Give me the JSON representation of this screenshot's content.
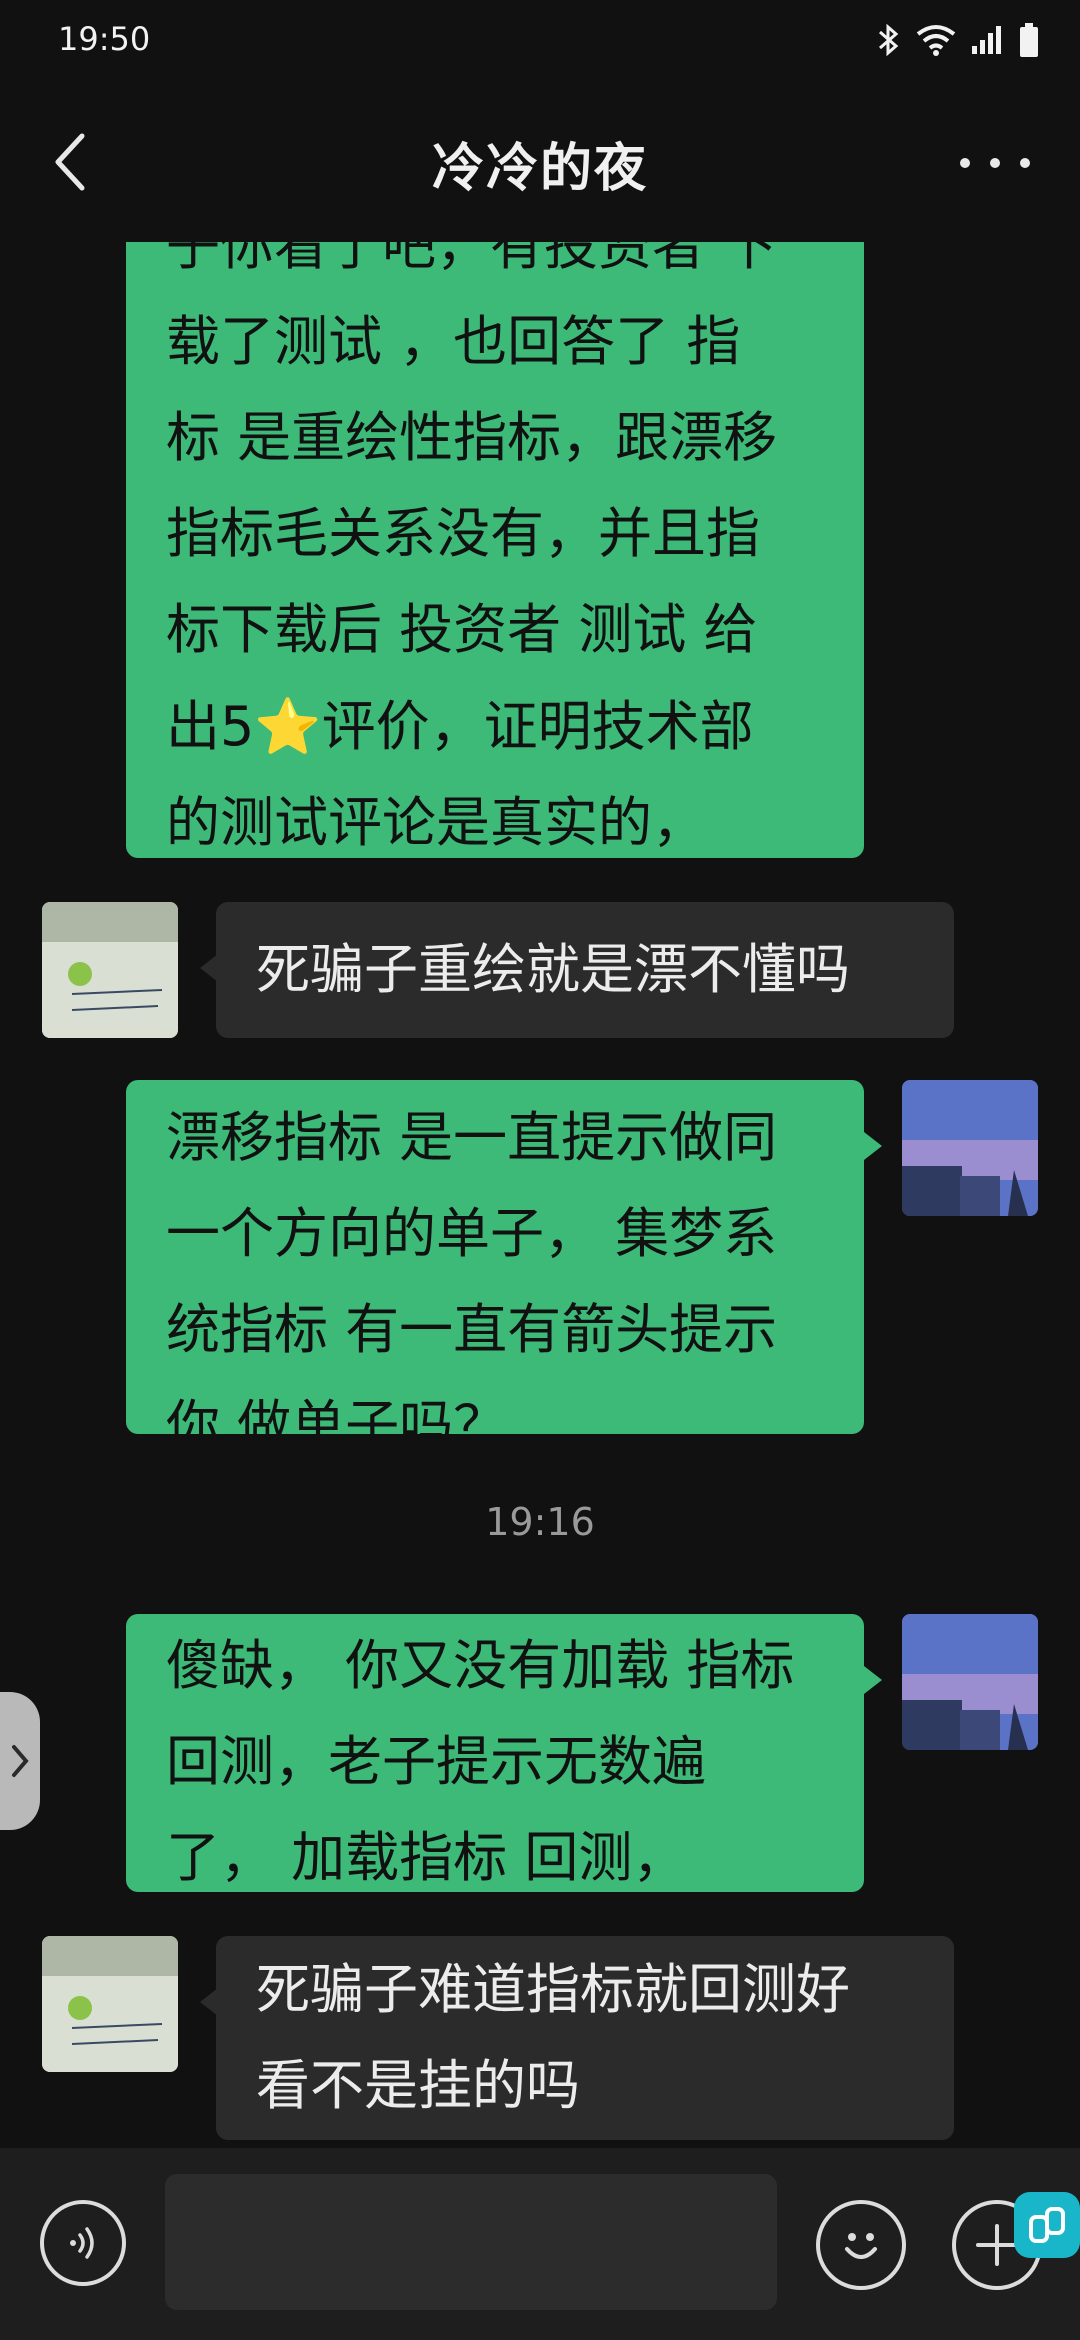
{
  "status_bar": {
    "time": "19:50"
  },
  "header": {
    "title": "冷冷的夜"
  },
  "messages": [
    {
      "side": "out",
      "lines": [
        "子你看了吧，有投资者 下",
        "载了测试 ，也回答了 指",
        "标 是重绘性指标，跟漂移",
        "指标毛关系没有，并且指",
        "标下载后  投资者 测试 给",
        "出5",
        "评价，证明技术部",
        "的测试评论是真实的，"
      ],
      "star": "⭐"
    },
    {
      "side": "in",
      "lines": [
        "死骗子重绘就是漂不懂吗"
      ]
    },
    {
      "side": "out",
      "lines": [
        "漂移指标 是一直提示做同",
        "一个方向的单子，  集梦系",
        "统指标 有一直有箭头提示",
        "你 做单子吗？"
      ]
    },
    {
      "side": "out",
      "lines": [
        "傻缺，  你又没有加载 指标",
        "回测，老子提示无数遍",
        "了，  加载指标 回测，"
      ]
    },
    {
      "side": "in",
      "lines": [
        "死骗子难道指标就回测好",
        "看不是挂的吗"
      ]
    }
  ],
  "timestamp": "19:16",
  "avatars": {
    "contact_note_text": [
      "你想做什么生意我都可以",
      "你有什么课程我都行"
    ]
  },
  "icons": {
    "back": "chevron-left-icon",
    "more": "more-dots-icon",
    "voice": "voice-icon",
    "emoji": "emoji-icon",
    "plus": "plus-icon",
    "expand": "chevron-right-icon"
  },
  "colors": {
    "outgoing_bubble": "#3db978",
    "incoming_bubble": "#2b2b2b",
    "background": "#111111"
  }
}
